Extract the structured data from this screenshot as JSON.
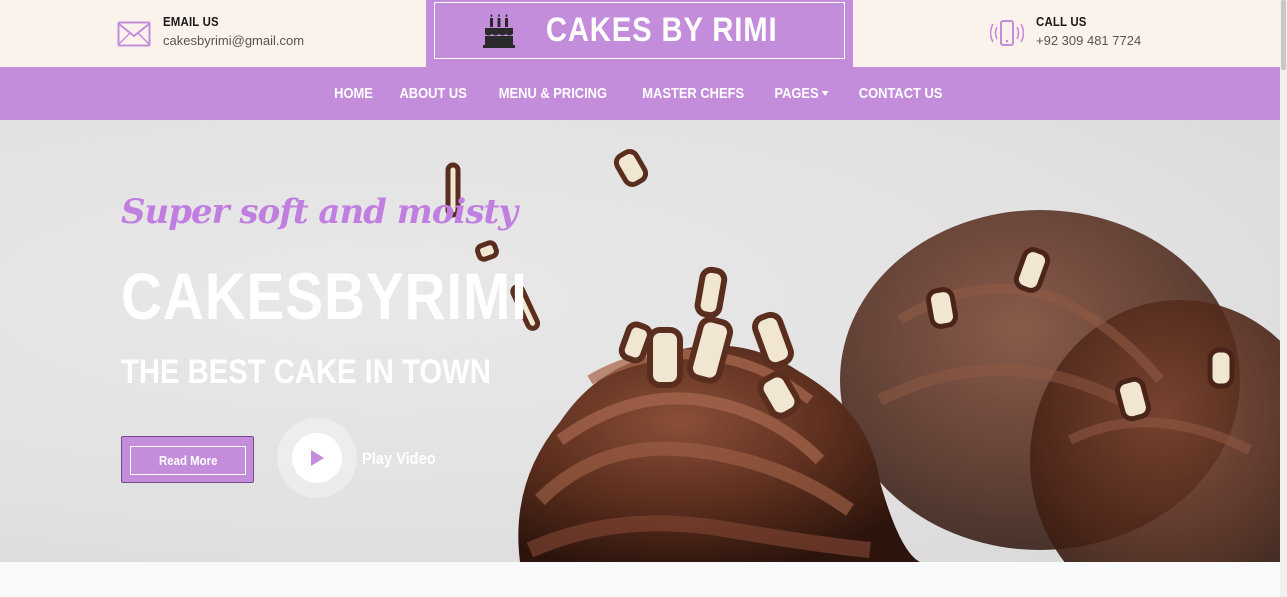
{
  "header": {
    "email": {
      "label": "EMAIL US",
      "value": "cakesbyrimi@gmail.com",
      "icon": "envelope-icon"
    },
    "phone": {
      "label": "CALL US",
      "value": "+92 309 481 7724",
      "icon": "phone-icon"
    },
    "brand": {
      "name": "CAKES BY RIMI",
      "icon": "birthday-cake-icon"
    }
  },
  "nav": {
    "items": [
      {
        "label": "HOME"
      },
      {
        "label": "ABOUT US"
      },
      {
        "label": "MENU & PRICING"
      },
      {
        "label": "MASTER CHEFS"
      },
      {
        "label": "PAGES"
      },
      {
        "label": "CONTACT US"
      }
    ]
  },
  "hero": {
    "tagline": "Super soft and moisty",
    "title": "CAKESBYRIMI",
    "subtitle": "THE BEST CAKE IN TOWN",
    "read_more": "Read More",
    "play_video": "Play Video"
  },
  "colors": {
    "accent": "#c48ddc",
    "topbar_bg": "#fbf2ec",
    "tagline": "#c07fe0",
    "chocolate": "#5a2e1f"
  }
}
